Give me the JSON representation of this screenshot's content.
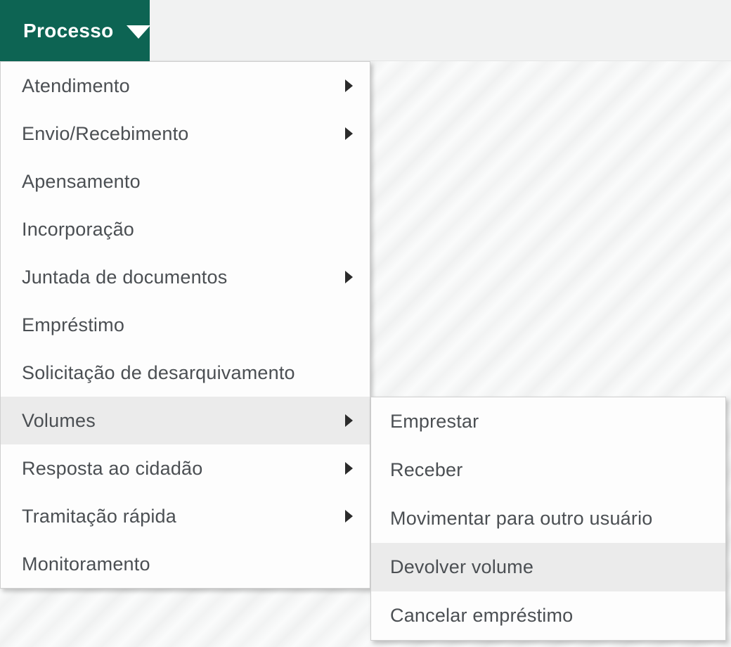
{
  "menu_button": {
    "label": "Processo"
  },
  "menu": {
    "items": [
      {
        "label": "Atendimento",
        "has_submenu": true
      },
      {
        "label": "Envio/Recebimento",
        "has_submenu": true
      },
      {
        "label": "Apensamento",
        "has_submenu": false
      },
      {
        "label": "Incorporação",
        "has_submenu": false
      },
      {
        "label": "Juntada de documentos",
        "has_submenu": true
      },
      {
        "label": "Empréstimo",
        "has_submenu": false
      },
      {
        "label": "Solicitação de desarquivamento",
        "has_submenu": false
      },
      {
        "label": "Volumes",
        "has_submenu": true,
        "highlighted": true
      },
      {
        "label": "Resposta ao cidadão",
        "has_submenu": true
      },
      {
        "label": "Tramitação rápida",
        "has_submenu": true
      },
      {
        "label": "Monitoramento",
        "has_submenu": false
      }
    ]
  },
  "submenu": {
    "parent": "Volumes",
    "items": [
      {
        "label": "Emprestar"
      },
      {
        "label": "Receber"
      },
      {
        "label": "Movimentar para outro usuário"
      },
      {
        "label": "Devolver volume",
        "highlighted": true
      },
      {
        "label": "Cancelar empréstimo"
      }
    ]
  },
  "colors": {
    "menu_button_bg": "#0d6453",
    "menu_button_text": "#ffffff",
    "menu_bg": "#fdfdfd",
    "menu_text": "#4b4f53",
    "highlight_bg": "#ebebeb",
    "menu_border": "#cfcfcf",
    "topbar_bg": "#f1f2f2",
    "arrow_color": "#2b2b2b"
  }
}
